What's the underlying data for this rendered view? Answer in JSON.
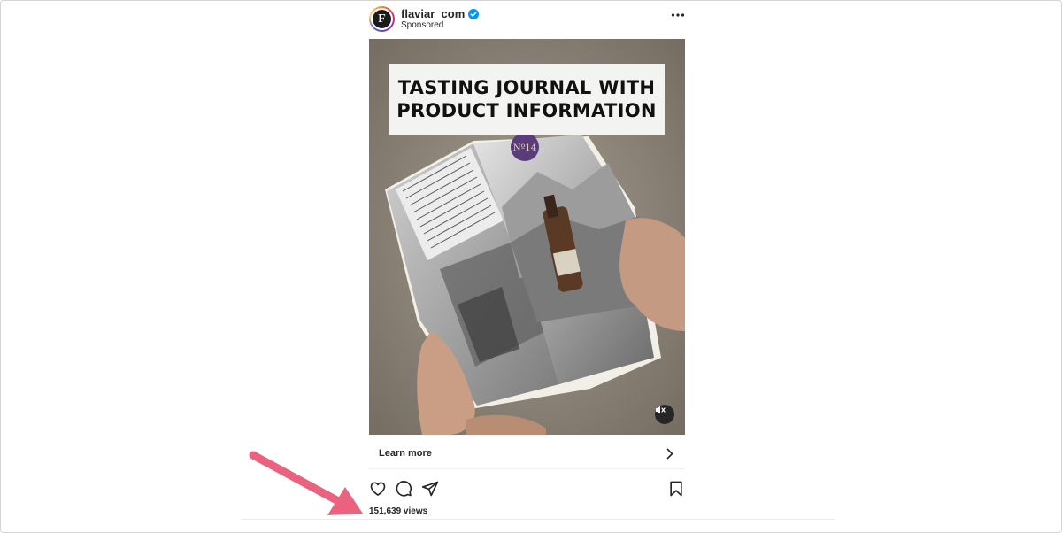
{
  "post": {
    "username": "flaviar_com",
    "avatar_letter": "F",
    "sponsored_label": "Sponsored",
    "verified": true,
    "more_icon": "more-horizontal-icon"
  },
  "media": {
    "overlay_line1": "TASTING JOURNAL WITH",
    "overlay_line2": "PRODUCT INFORMATION",
    "mute_icon": "volume-muted-icon"
  },
  "cta": {
    "label": "Learn more",
    "icon": "chevron-right-icon"
  },
  "actions": {
    "like_icon": "heart-icon",
    "comment_icon": "comment-icon",
    "share_icon": "share-icon",
    "save_icon": "bookmark-icon"
  },
  "views_text": "151,639 views",
  "annotation": {
    "arrow_color": "#e9627e"
  }
}
